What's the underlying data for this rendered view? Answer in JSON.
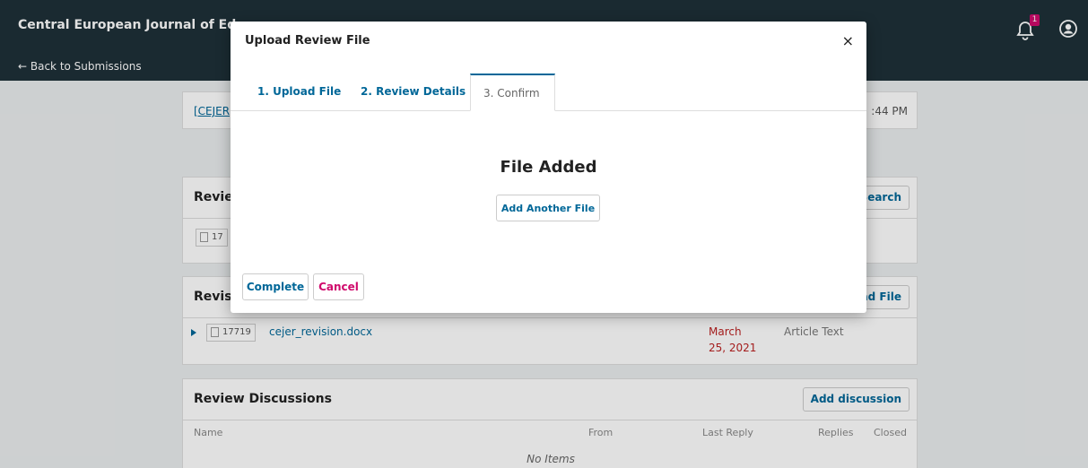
{
  "header": {
    "journal_title": "Central European Journal of Educ",
    "back_link": "← Back to Submissions",
    "notification_count": "1"
  },
  "background": {
    "submission_link": "[CEJER]",
    "time_fragment": ":44 PM",
    "review_files": {
      "title": "Revie",
      "button": "Search",
      "file_id_fragment": "17"
    },
    "revisions": {
      "title": "Revisi",
      "button": "ad File",
      "file": {
        "id": "17719",
        "name": "cejer_revision.docx",
        "date_line1": "March",
        "date_line2": "25, 2021",
        "type": "Article Text"
      }
    },
    "discussions": {
      "title": "Review Discussions",
      "button": "Add discussion",
      "columns": {
        "name": "Name",
        "from": "From",
        "last_reply": "Last Reply",
        "replies": "Replies",
        "closed": "Closed"
      },
      "empty": "No Items"
    }
  },
  "modal": {
    "title": "Upload Review File",
    "close": "×",
    "tabs": [
      "1. Upload File",
      "2. Review Details",
      "3. Confirm"
    ],
    "active_tab": "3. Confirm",
    "heading": "File Added",
    "add_another": "Add Another File",
    "complete": "Complete",
    "cancel": "Cancel"
  },
  "colors": {
    "header_bg": "#1e3038",
    "link_blue": "#006798",
    "cancel_pink": "#d00a6c",
    "date_red": "#b22222"
  }
}
